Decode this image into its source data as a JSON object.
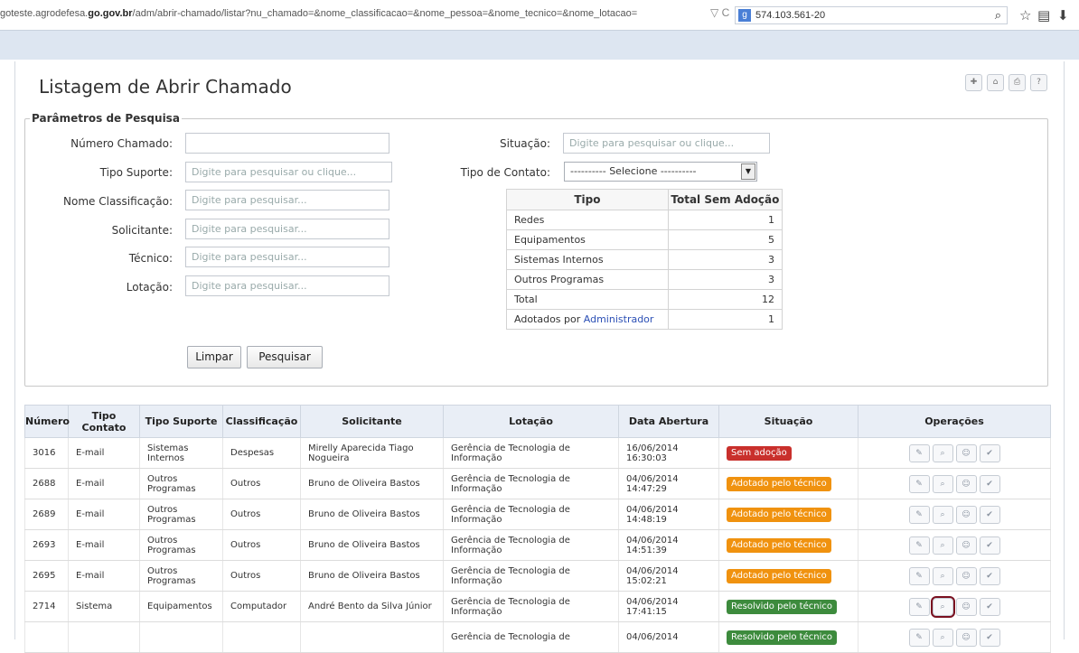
{
  "browser": {
    "url_prefix": "goteste.agrodefesa.",
    "url_domain": "go.gov.br",
    "url_path": "/adm/abrir-chamado/listar?nu_chamado=&nome_classificacao=&nome_pessoa=&nome_tecnico=&nome_lotacao=",
    "url_icons": "▽ C",
    "search_value": "574.103.561-20"
  },
  "page": {
    "title": "Listagem de Abrir Chamado"
  },
  "params": {
    "legend": "Parâmetros de Pesquisa",
    "numero_label": "Número Chamado:",
    "tipo_suporte_label": "Tipo Suporte:",
    "tipo_suporte_placeholder": "Digite para pesquisar ou clique...",
    "classificacao_label": "Nome Classificação:",
    "classificacao_placeholder": "Digite para pesquisar...",
    "solicitante_label": "Solicitante:",
    "solicitante_placeholder": "Digite para pesquisar...",
    "tecnico_label": "Técnico:",
    "tecnico_placeholder": "Digite para pesquisar...",
    "lotacao_label": "Lotação:",
    "lotacao_placeholder": "Digite para pesquisar...",
    "situacao_label": "Situação:",
    "situacao_placeholder": "Digite para pesquisar ou clique...",
    "tipo_contato_label": "Tipo de Contato:",
    "tipo_contato_value": "---------- Selecione ----------",
    "limpar": "Limpar",
    "pesquisar": "Pesquisar"
  },
  "summary": {
    "headers": [
      "Tipo",
      "Total Sem Adoção"
    ],
    "rows": [
      [
        "Redes",
        "1"
      ],
      [
        "Equipamentos",
        "5"
      ],
      [
        "Sistemas Internos",
        "3"
      ],
      [
        "Outros Programas",
        "3"
      ],
      [
        "Total",
        "12"
      ]
    ],
    "adotados_label": "Adotados por",
    "adotados_name": "Administrador",
    "adotados_value": "1"
  },
  "table": {
    "headers": [
      "Número",
      "Tipo Contato",
      "Tipo Suporte",
      "Classificação",
      "Solicitante",
      "Lotação",
      "Data Abertura",
      "Situação",
      "Operações"
    ],
    "rows": [
      {
        "numero": "3016",
        "contato": "E-mail",
        "suporte": "Sistemas Internos",
        "classificacao": "Despesas",
        "solicitante": "Mirelly Aparecida Tiago Nogueira",
        "lotacao": "Gerência de Tecnologia de Informação",
        "data": "16/06/2014",
        "hora": "16:30:03",
        "situacao": "Sem adoção",
        "cor": "#c9302c"
      },
      {
        "numero": "2688",
        "contato": "E-mail",
        "suporte": "Outros Programas",
        "classificacao": "Outros",
        "solicitante": "Bruno de Oliveira Bastos",
        "lotacao": "Gerência de Tecnologia de Informação",
        "data": "04/06/2014",
        "hora": "14:47:29",
        "situacao": "Adotado pelo técnico",
        "cor": "#f0920f"
      },
      {
        "numero": "2689",
        "contato": "E-mail",
        "suporte": "Outros Programas",
        "classificacao": "Outros",
        "solicitante": "Bruno de Oliveira Bastos",
        "lotacao": "Gerência de Tecnologia de Informação",
        "data": "04/06/2014",
        "hora": "14:48:19",
        "situacao": "Adotado pelo técnico",
        "cor": "#f0920f"
      },
      {
        "numero": "2693",
        "contato": "E-mail",
        "suporte": "Outros Programas",
        "classificacao": "Outros",
        "solicitante": "Bruno de Oliveira Bastos",
        "lotacao": "Gerência de Tecnologia de Informação",
        "data": "04/06/2014",
        "hora": "14:51:39",
        "situacao": "Adotado pelo técnico",
        "cor": "#f0920f"
      },
      {
        "numero": "2695",
        "contato": "E-mail",
        "suporte": "Outros Programas",
        "classificacao": "Outros",
        "solicitante": "Bruno de Oliveira Bastos",
        "lotacao": "Gerência de Tecnologia de Informação",
        "data": "04/06/2014",
        "hora": "15:02:21",
        "situacao": "Adotado pelo técnico",
        "cor": "#f0920f"
      },
      {
        "numero": "2714",
        "contato": "Sistema",
        "suporte": "Equipamentos",
        "classificacao": "Computador",
        "solicitante": "André Bento da Silva Júnior",
        "lotacao": "Gerência de Tecnologia de Informação",
        "data": "04/06/2014",
        "hora": "17:41:15",
        "situacao": "Resolvido pelo técnico",
        "cor": "#3d8b3d"
      },
      {
        "numero": "",
        "contato": "",
        "suporte": "",
        "classificacao": "",
        "solicitante": "",
        "lotacao": "Gerência de Tecnologia de",
        "data": "04/06/2014",
        "hora": "",
        "situacao": "Resolvido pelo técnico",
        "cor": "#3d8b3d"
      }
    ]
  }
}
